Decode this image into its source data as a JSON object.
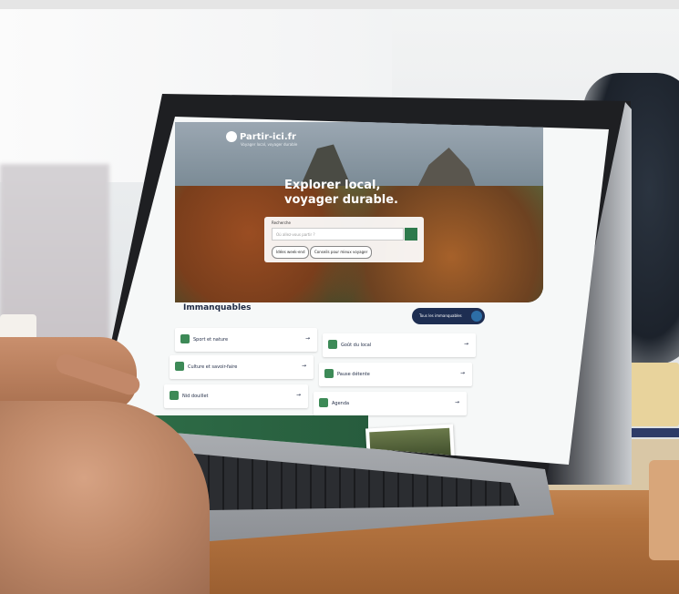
{
  "site": {
    "logo_text": "Partir-ici.fr",
    "logo_tagline": "Voyager local, voyager durable",
    "hero_title": "Explorer local, voyager durable.",
    "search_label": "Recherche",
    "search_placeholder": "Où allez-vous partir ?",
    "pills": [
      "Idées week-end",
      "Conseils pour mieux voyager"
    ],
    "section_title": "Immanquables",
    "all_button": "Tous les immanquables",
    "cards": [
      {
        "label": "Sport et nature"
      },
      {
        "label": "Goût du local"
      },
      {
        "label": "Culture et savoir-faire"
      },
      {
        "label": "Pause détente"
      },
      {
        "label": "Nid douillet"
      },
      {
        "label": "Agenda"
      }
    ],
    "arrow": "→"
  }
}
